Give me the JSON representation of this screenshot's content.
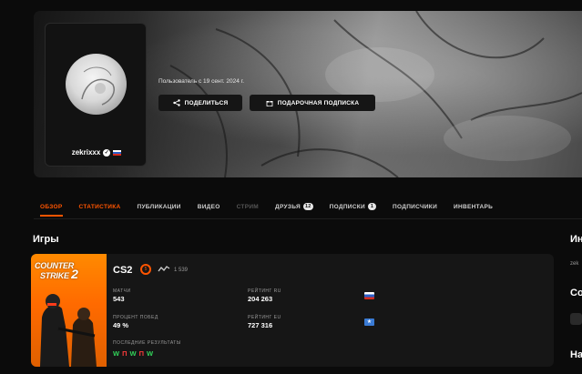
{
  "profile": {
    "username": "zekrixxx",
    "member_since": "Пользователь с 19 сент. 2024 г.",
    "share_label": "ПОДЕЛИТЬСЯ",
    "gift_label": "ПОДАРОЧНАЯ ПОДПИСКА",
    "country_flag": "russia-flag-icon"
  },
  "tabs": [
    {
      "label": "ОБЗОР",
      "state": "active"
    },
    {
      "label": "СТАТИСТИКА",
      "state": "highlight"
    },
    {
      "label": "ПУБЛИКАЦИИ",
      "state": "normal"
    },
    {
      "label": "ВИДЕО",
      "state": "normal"
    },
    {
      "label": "СТРИМ",
      "state": "disabled"
    },
    {
      "label": "ДРУЗЬЯ",
      "count": "12",
      "state": "normal"
    },
    {
      "label": "ПОДПИСКИ",
      "count": "1",
      "state": "normal"
    },
    {
      "label": "ПОДПИСЧИКИ",
      "state": "normal"
    },
    {
      "label": "ИНВЕНТАРЬ",
      "state": "normal"
    }
  ],
  "games": {
    "title": "Игры",
    "cs2": {
      "cover_title_line1": "COUNTER",
      "cover_title_line2": "STRIKE",
      "cover_number": "2",
      "name": "CS2",
      "level": "5",
      "elo": "1 539",
      "matches_label": "МАТЧИ",
      "matches_value": "543",
      "winrate_label": "ПРОЦЕНТ ПОБЕД",
      "winrate_value": "49 %",
      "recent_label": "ПОСЛЕДНИЕ РЕЗУЛЬТАТЫ",
      "recent_results": [
        "W",
        "П",
        "W",
        "П",
        "W"
      ],
      "rating_ru_label": "РЕЙТИНГ RU",
      "rating_ru_value": "204 263",
      "rating_eu_label": "РЕЙТИНГ EU",
      "rating_eu_value": "727 316"
    }
  },
  "right_column": {
    "heading1": "Ин",
    "small_text": "zek",
    "heading2": "Со",
    "heading3": "На"
  },
  "colors": {
    "accent": "#ff5500",
    "win": "#32d35a",
    "loss": "#ff3b3b",
    "background": "#0b0b0b"
  }
}
